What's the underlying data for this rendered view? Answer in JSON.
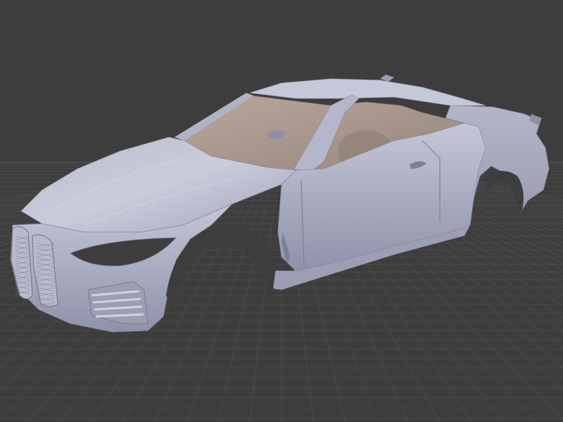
{
  "viewport": {
    "background_color": "#3d3d3d",
    "grid_color": "#4a4a4a",
    "grid": "on",
    "shading": "solid"
  },
  "model": {
    "body_color": "#a9acc0",
    "highlight_color": "#c8cbdb",
    "interior_color": "#a8968c",
    "shadow_color": "#6f7287",
    "icon": "car-body-mesh"
  }
}
